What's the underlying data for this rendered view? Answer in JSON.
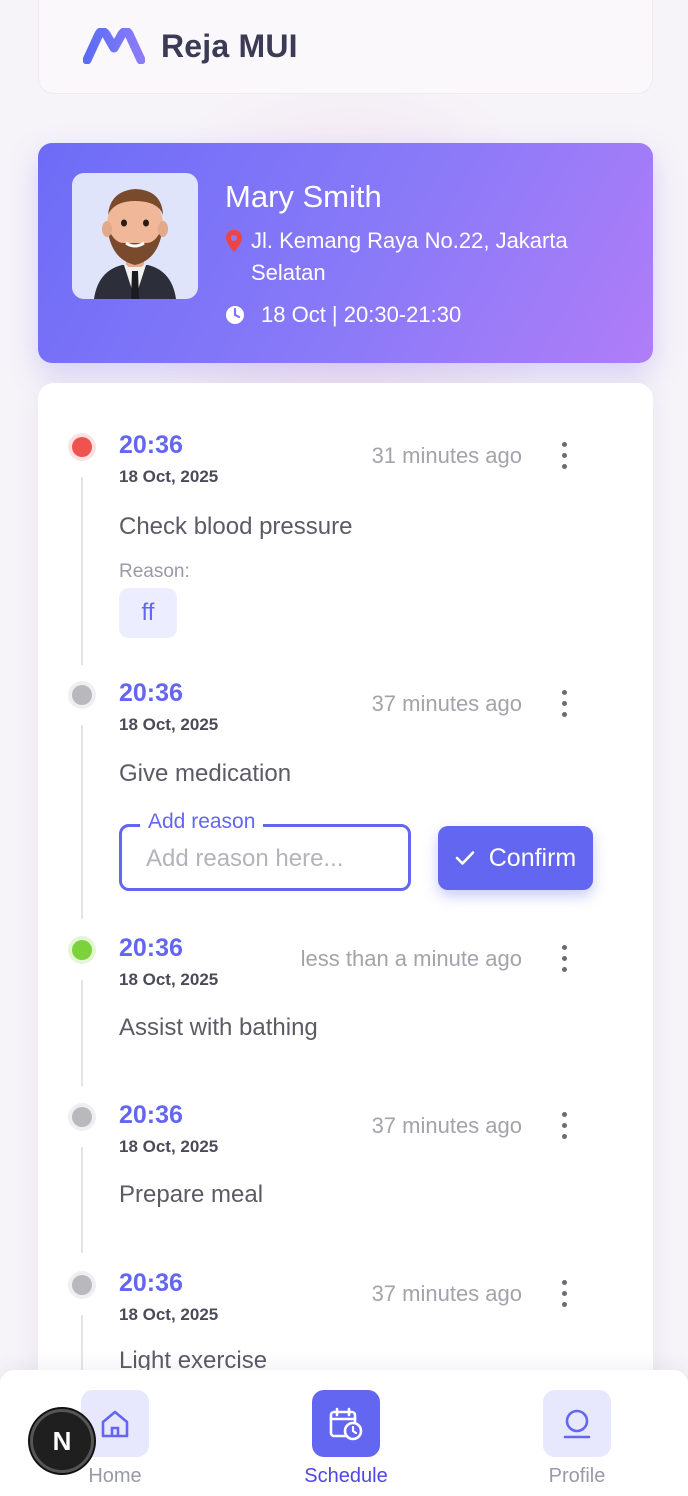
{
  "app": {
    "title": "Reja MUI"
  },
  "profile": {
    "name": "Mary Smith",
    "address": "Jl. Kemang Raya No.22, Jakarta Selatan",
    "schedule": "18 Oct | 20:30-21:30"
  },
  "timeline": [
    {
      "time": "20:36",
      "date": "18 Oct, 2025",
      "ago": "31 minutes ago",
      "task": "Check blood pressure",
      "status": "red",
      "reason_label": "Reason:",
      "reason": "ff"
    },
    {
      "time": "20:36",
      "date": "18 Oct, 2025",
      "ago": "37 minutes ago",
      "task": "Give medication",
      "status": "gray",
      "reason_field_label": "Add reason",
      "reason_placeholder": "Add reason here...",
      "confirm_label": "Confirm"
    },
    {
      "time": "20:36",
      "date": "18 Oct, 2025",
      "ago": "less than a minute ago",
      "task": "Assist with bathing",
      "status": "green"
    },
    {
      "time": "20:36",
      "date": "18 Oct, 2025",
      "ago": "37 minutes ago",
      "task": "Prepare meal",
      "status": "gray"
    },
    {
      "time": "20:36",
      "date": "18 Oct, 2025",
      "ago": "37 minutes ago",
      "task": "Light exercise",
      "status": "gray"
    }
  ],
  "nav": {
    "items": [
      {
        "label": "Home",
        "icon": "home-icon"
      },
      {
        "label": "Schedule",
        "icon": "calendar-clock-icon",
        "active": true
      },
      {
        "label": "Profile",
        "icon": "user-icon"
      }
    ]
  },
  "overlay_badge": "N",
  "colors": {
    "accent": "#6366f1",
    "status_red": "#ef5350",
    "status_green": "#7bd23b",
    "status_gray": "#b9b9bd"
  }
}
